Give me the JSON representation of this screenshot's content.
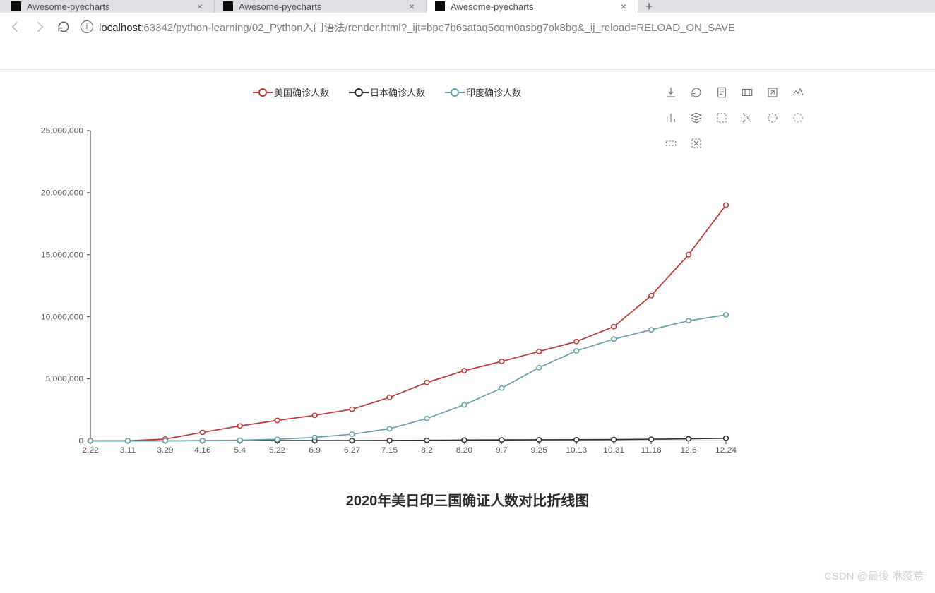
{
  "browser": {
    "tabs": [
      {
        "title": "Awesome-pyecharts",
        "active": false
      },
      {
        "title": "Awesome-pyecharts",
        "active": false
      },
      {
        "title": "Awesome-pyecharts",
        "active": true
      }
    ],
    "url_host": "localhost",
    "url_rest": ":63342/python-learning/02_Python入门语法/render.html?_ijt=bpe7b6sataq5cqm0asbg7ok8bg&_ij_reload=RELOAD_ON_SAVE"
  },
  "legend": {
    "items": [
      {
        "label": "美国确诊人数",
        "color": "#c23531"
      },
      {
        "label": "日本确诊人数",
        "color": "#2f2f2f"
      },
      {
        "label": "印度确诊人数",
        "color": "#61a0a8"
      }
    ]
  },
  "toolbox": {
    "icons": [
      "download",
      "refresh",
      "data-view",
      "area-zoom",
      "zoom-reset",
      "line-type",
      "bar-type",
      "stack",
      "restore",
      "brush-rect",
      "brush-polygon",
      "brush-keep",
      "brush-x",
      "brush-clear"
    ]
  },
  "chart_data": {
    "type": "line",
    "title": "2020年美日印三国确证人数对比折线图",
    "xlabel": "",
    "ylabel": "",
    "ylim": [
      0,
      25000000
    ],
    "yticks": [
      0,
      5000000,
      10000000,
      15000000,
      20000000,
      25000000
    ],
    "ytick_labels": [
      "0",
      "5,000,000",
      "10,000,000",
      "15,000,000",
      "20,000,000",
      "25,000,000"
    ],
    "categories": [
      "2.22",
      "3.11",
      "3.29",
      "4.16",
      "5.4",
      "5.22",
      "6.9",
      "6.27",
      "7.15",
      "8.2",
      "8.20",
      "9.7",
      "9.25",
      "10.13",
      "10.31",
      "11.18",
      "12.6",
      "12.24"
    ],
    "series": [
      {
        "name": "美国确诊人数",
        "color": "#c23531",
        "values": [
          30,
          1000,
          140000,
          680000,
          1200000,
          1650000,
          2050000,
          2550000,
          3500000,
          4700000,
          5650000,
          6400000,
          7200000,
          8000000,
          9200000,
          11700000,
          15000000,
          19000000
        ]
      },
      {
        "name": "日本确诊人数",
        "color": "#2f2f2f",
        "values": [
          100,
          600,
          1900,
          9000,
          15000,
          16500,
          17200,
          18300,
          23000,
          38000,
          58000,
          72000,
          81000,
          90000,
          100000,
          123000,
          160000,
          210000
        ]
      },
      {
        "name": "印度确诊人数",
        "color": "#61a0a8",
        "values": [
          3,
          60,
          1000,
          13000,
          46000,
          125000,
          275000,
          530000,
          970000,
          1800000,
          2900000,
          4250000,
          5900000,
          7250000,
          8200000,
          8950000,
          9680000,
          10150000
        ]
      }
    ]
  },
  "watermark": "CSDN @最後 咻莈莣"
}
